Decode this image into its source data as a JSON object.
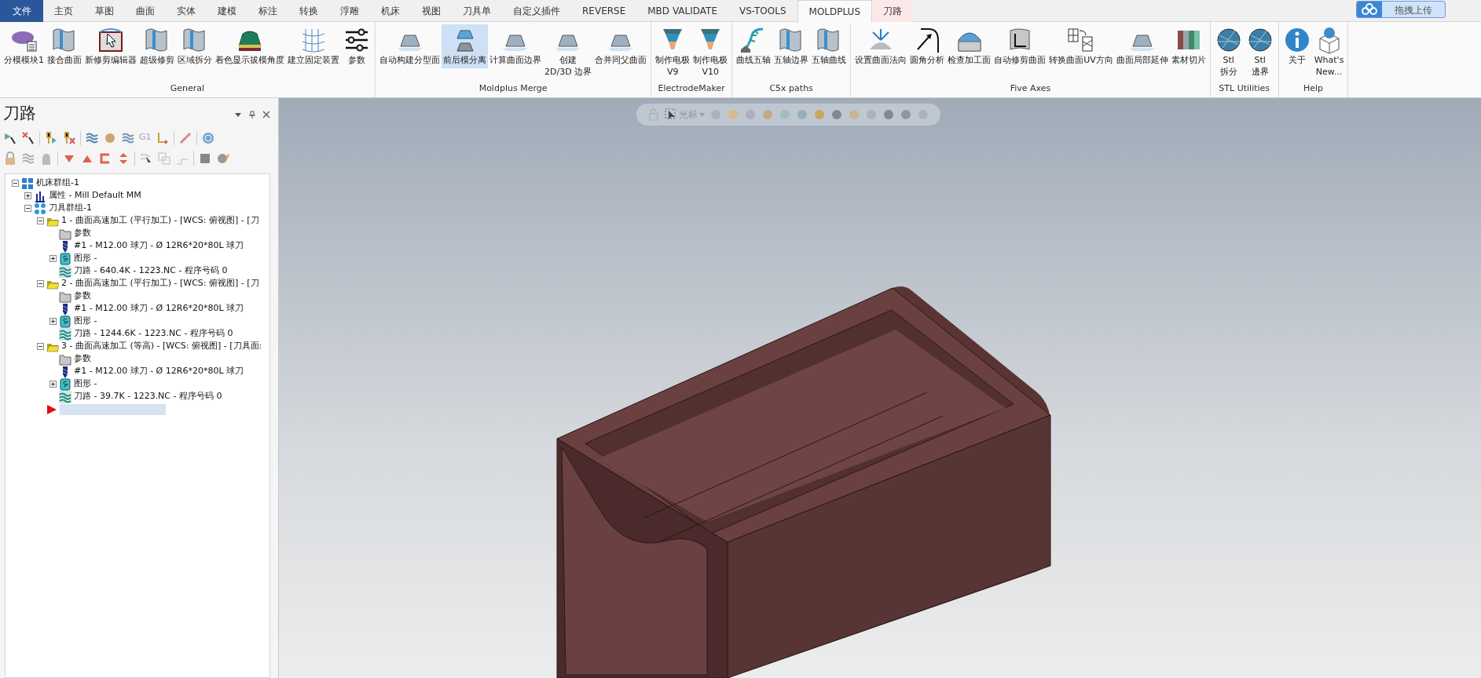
{
  "menu_tabs": [
    {
      "label": "文件",
      "kind": "file",
      "selected": false
    },
    {
      "label": "主页",
      "kind": "tab",
      "selected": false
    },
    {
      "label": "草图",
      "kind": "tab",
      "selected": false
    },
    {
      "label": "曲面",
      "kind": "tab",
      "selected": false
    },
    {
      "label": "实体",
      "kind": "tab",
      "selected": false
    },
    {
      "label": "建模",
      "kind": "tab",
      "selected": false
    },
    {
      "label": "标注",
      "kind": "tab",
      "selected": false
    },
    {
      "label": "转换",
      "kind": "tab",
      "selected": false
    },
    {
      "label": "浮雕",
      "kind": "tab",
      "selected": false
    },
    {
      "label": "机床",
      "kind": "tab",
      "selected": false
    },
    {
      "label": "视图",
      "kind": "tab",
      "selected": false
    },
    {
      "label": "刀具单",
      "kind": "tab",
      "selected": false
    },
    {
      "label": "自定义插件",
      "kind": "tab",
      "selected": false
    },
    {
      "label": "REVERSE",
      "kind": "tab",
      "selected": false
    },
    {
      "label": "MBD VALIDATE",
      "kind": "tab",
      "selected": false
    },
    {
      "label": "VS-TOOLS",
      "kind": "tab",
      "selected": false
    },
    {
      "label": "MOLDPLUS",
      "kind": "tab",
      "selected": true
    },
    {
      "label": "刀路",
      "kind": "context",
      "selected": false
    }
  ],
  "upload_button": {
    "label": "拖拽上传"
  },
  "ribbon_groups": [
    {
      "label": "General",
      "buttons": [
        {
          "label": "分模模块1",
          "selected": false
        },
        {
          "label": "接合曲面",
          "selected": false
        },
        {
          "label": "新修剪编辑器",
          "selected": false
        },
        {
          "label": "超级修剪",
          "selected": false
        },
        {
          "label": "区域拆分",
          "selected": false
        },
        {
          "label": "着色显示拔模角度",
          "selected": false
        },
        {
          "label": "建立固定装置",
          "selected": false
        },
        {
          "label": "参数",
          "selected": false
        }
      ]
    },
    {
      "label": "Moldplus Merge",
      "buttons": [
        {
          "label": "自动构建分型面",
          "selected": false
        },
        {
          "label": "前后模分离",
          "selected": true
        },
        {
          "label": "计算曲面边界",
          "selected": false
        },
        {
          "label": "创建\n2D/3D 边界",
          "selected": false
        },
        {
          "label": "合并同父曲面",
          "selected": false
        }
      ]
    },
    {
      "label": "ElectrodeMaker",
      "buttons": [
        {
          "label": "制作电极\nV9",
          "selected": false
        },
        {
          "label": "制作电极\nV10",
          "selected": false
        }
      ]
    },
    {
      "label": "C5x paths",
      "buttons": [
        {
          "label": "曲线五轴",
          "selected": false
        },
        {
          "label": "五轴边界",
          "selected": false
        },
        {
          "label": "五轴曲线",
          "selected": false
        }
      ]
    },
    {
      "label": "Five Axes",
      "buttons": [
        {
          "label": "设置曲面法向",
          "selected": false
        },
        {
          "label": "圆角分析",
          "selected": false
        },
        {
          "label": "检查加工面",
          "selected": false
        },
        {
          "label": "自动修剪曲面",
          "selected": false
        },
        {
          "label": "转换曲面UV方向",
          "selected": false
        },
        {
          "label": "曲面局部延伸",
          "selected": false
        },
        {
          "label": "素材切片",
          "selected": false
        }
      ]
    },
    {
      "label": "STL Utilities",
      "buttons": [
        {
          "label": "Stl\n拆分",
          "selected": false
        },
        {
          "label": "Stl\n邊界",
          "selected": false
        }
      ]
    },
    {
      "label": "Help",
      "buttons": [
        {
          "label": "关于",
          "selected": false
        },
        {
          "label": "What's\nNew...",
          "selected": false
        }
      ]
    }
  ],
  "panel": {
    "title": "刀路",
    "toolbar_text": "G1"
  },
  "tree": [
    {
      "kind": "machine-group",
      "label": "机床群组-1",
      "expanded": true,
      "children": [
        {
          "kind": "properties",
          "label": "属性 - Mill Default MM",
          "expanded": false
        },
        {
          "kind": "tool-group",
          "label": "刀具群组-1",
          "expanded": true,
          "children": [
            {
              "kind": "operation",
              "label": "1 - 曲面高速加工 (平行加工) - [WCS: 俯视图] - [刀",
              "expanded": true,
              "children": [
                {
                  "kind": "params",
                  "label": "参数"
                },
                {
                  "kind": "tool",
                  "label": "#1 - M12.00 球刀 - Ø 12R6*20*80L 球刀"
                },
                {
                  "kind": "geometry",
                  "label": "图形 -",
                  "expanded": false
                },
                {
                  "kind": "toolpath",
                  "label": "刀路 - 640.4K - 1223.NC - 程序号码 0"
                }
              ]
            },
            {
              "kind": "operation",
              "label": "2 - 曲面高速加工 (平行加工) - [WCS: 俯视图] - [刀",
              "expanded": true,
              "children": [
                {
                  "kind": "params",
                  "label": "参数"
                },
                {
                  "kind": "tool",
                  "label": "#1 - M12.00 球刀 - Ø 12R6*20*80L 球刀"
                },
                {
                  "kind": "geometry",
                  "label": "图形 -",
                  "expanded": false
                },
                {
                  "kind": "toolpath",
                  "label": "刀路 - 1244.6K - 1223.NC - 程序号码 0"
                }
              ]
            },
            {
              "kind": "operation",
              "label": "3 - 曲面高速加工 (等高) - [WCS: 俯视图] - [刀具面:",
              "expanded": true,
              "children": [
                {
                  "kind": "params",
                  "label": "参数"
                },
                {
                  "kind": "tool",
                  "label": "#1 - M12.00 球刀 - Ø 12R6*20*80L 球刀"
                },
                {
                  "kind": "geometry",
                  "label": "图形 -",
                  "expanded": false
                },
                {
                  "kind": "toolpath",
                  "label": "刀路 - 39.7K - 1223.NC - 程序号码 0"
                }
              ]
            },
            {
              "kind": "insert"
            }
          ]
        }
      ]
    }
  ],
  "viewport_toolbar": {
    "label": "光标"
  }
}
